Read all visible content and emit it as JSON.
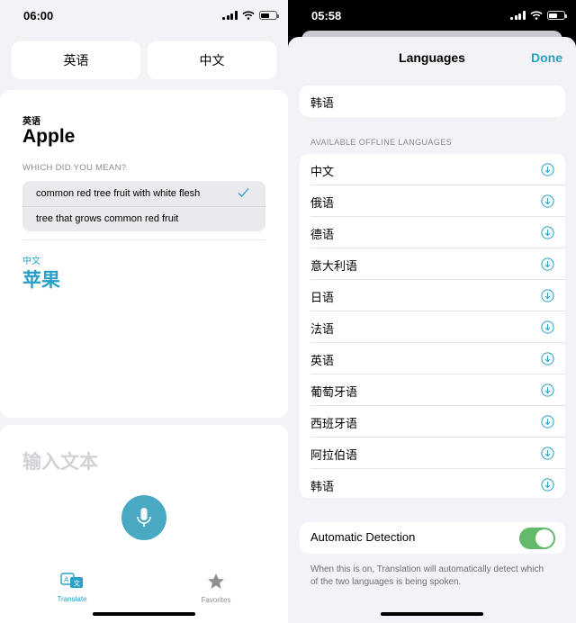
{
  "left": {
    "status": {
      "time": "06:00"
    },
    "source_lang_button": "英语",
    "target_lang_button": "中文",
    "card": {
      "source_lang": "英语",
      "source_word": "Apple",
      "which_label": "WHICH DID YOU MEAN?",
      "options": [
        {
          "label": "common red tree fruit with white flesh",
          "selected": true
        },
        {
          "label": "tree that grows common red fruit",
          "selected": false
        }
      ],
      "target_lang": "中文",
      "target_word": "苹果"
    },
    "input_placeholder": "输入文本",
    "tabs": [
      {
        "label": "Translate",
        "icon": "translate-icon",
        "active": true
      },
      {
        "label": "Favorites",
        "icon": "star-icon",
        "active": false
      }
    ]
  },
  "right": {
    "status": {
      "time": "05:58"
    },
    "nav": {
      "title": "Languages",
      "done": "Done"
    },
    "downloaded": [
      "韩语"
    ],
    "section_header": "AVAILABLE OFFLINE LANGUAGES",
    "available": [
      "中文",
      "俄语",
      "德语",
      "意大利语",
      "日语",
      "法语",
      "英语",
      "葡萄牙语",
      "西班牙语",
      "阿拉伯语",
      "韩语"
    ],
    "auto_detect": {
      "label": "Automatic Detection",
      "on": true
    },
    "footer": "When this is on, Translation will automatically detect which of the two languages is being spoken."
  },
  "colors": {
    "accent": "#2a9fc8",
    "mic": "#4aa9c2",
    "toggle_on": "#63b96a",
    "background": "#f2f2f7"
  }
}
